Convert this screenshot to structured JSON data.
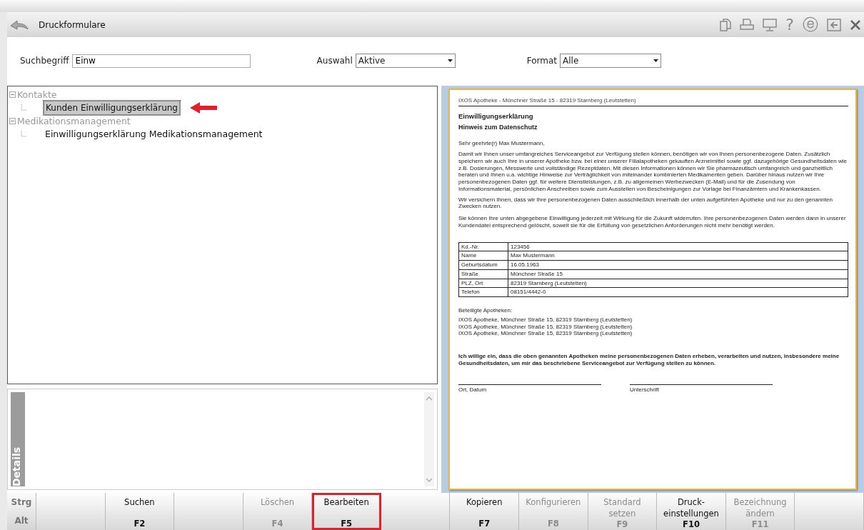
{
  "window": {
    "title": "Druckformulare"
  },
  "title_icons": [
    {
      "kind": "copy"
    },
    {
      "kind": "print"
    },
    {
      "kind": "monitor"
    },
    {
      "kind": "glyph",
      "glyph": "?"
    },
    {
      "kind": "glyph",
      "glyph": "ⓔ"
    },
    {
      "kind": "exit"
    },
    {
      "kind": "close"
    }
  ],
  "filters": {
    "search": {
      "label": "Suchbegriff",
      "value": "Einw"
    },
    "auswahl": {
      "label": "Auswahl",
      "value": "Aktive"
    },
    "format": {
      "label": "Format",
      "value": "Alle"
    }
  },
  "tree": [
    {
      "label": "Kontakte",
      "expanded": true,
      "children": [
        {
          "label": "Kunden Einwilligungserklärung",
          "selected": true,
          "pointer": true
        }
      ]
    },
    {
      "label": "Medikationsmanagement",
      "expanded": true,
      "children": [
        {
          "label": "Einwilligungserklärung Medikationsmanagement",
          "selected": false,
          "pointer": false
        }
      ]
    }
  ],
  "details": {
    "label": "Details"
  },
  "document": {
    "header": "IXOS Apotheke - Münchner Straße 15 - 82319 Starnberg (Leutstetten)",
    "title": "Einwilligungserklärung",
    "subtitle": "Hinweis zum Datenschutz",
    "salutation": "Sehr geehrte(r)  Max Mustermann,",
    "paragraphs": [
      "Damit wir Ihnen unser umfangreiches Serviceangebot zur Verfügung stellen können, benötigen wir von Ihnen personenbezogene Daten. Zusätzlich speichern wir auch Ihre in unserer Apotheke bzw. bei einer unserer Filialapotheken gekauften Arzneimittel sowie ggf. dazugehörige Gesundheitsdaten wie z.B. Dosierungen, Messwerte und vollständige Rezeptdaten. Mit diesen Informationen können wir Sie pharmazeutisch umfangreich und ganzheitlich beraten und Ihnen u.a. wichtige Hinweise zur Verträglichkeit von miteinander kombinierten Medikamenten geben. Darüber hinaus nutzen wir Ihre personenbezogenen Daten ggf. für weitere Dienstleistungen, z.B. zu allgemeinen Werbezwecken (E-Mail) und für die Zusendung von Informationsmaterial, persönlichen Anschreiben sowie zum Ausstellen von Bescheinigungen zur Vorlage bei Finanzämtern und Krankenkassen.",
      "Wir versichern Ihnen, dass wir Ihre personenbezogenen Daten ausschließlich innerhalb der unten aufgeführten Apotheke und nur zu den genannten Zwecken nutzen.",
      "Sie können Ihre unten abgegebene Einwilligung jederzeit mit Wirkung für die Zukunft widerrufen. Ihre personenbezogenen Daten werden dann in unserer Kundendatei entsprechend gelöscht, soweit sie für die Erfüllung von gesetzlichen Anforderungen nicht mehr benötigt werden."
    ],
    "table": [
      {
        "label": "Kd.-Nr.",
        "value": "123456"
      },
      {
        "label": "Name",
        "value": "Max Mustermann"
      },
      {
        "label": "Geburtsdatum",
        "value": "16.05.1963"
      },
      {
        "label": "Straße",
        "value": "Münchner Straße 15"
      },
      {
        "label": "PLZ, Ort",
        "value": "82319 Starnberg (Leutstetten)"
      },
      {
        "label": "Telefon",
        "value": "08151/4442-0"
      }
    ],
    "pharmacies_label": "Beteiligte Apotheken:",
    "pharmacies": [
      "IXOS Apotheke, Münchner Straße 15, 82319 Starnberg (Leutstetten)",
      "IXOS Apotheke, Münchner Straße 15, 82319 Starnberg (Leutstetten)",
      "IXOS Apotheke, Münchner Straße 15, 82319 Starnberg (Leutstetten)"
    ],
    "consent": "Ich willige ein, dass die oben genannten Apotheken meine personenbezogenen Daten erheben, verarbeiten und nutzen, insbesondere meine Gesundheitsdaten, um mir das beschriebene Serviceangebot zur Verfügung stellen zu können.",
    "signatures": [
      "Ort, Datum",
      "Unterschrift"
    ]
  },
  "modifiers": [
    "Strg",
    "Alt"
  ],
  "function_keys": [
    {
      "kind": "blank"
    },
    {
      "kind": "action",
      "label": "Suchen",
      "key": "F2",
      "disabled": false,
      "highlighted": false
    },
    {
      "kind": "blank"
    },
    {
      "kind": "action",
      "label": "Löschen",
      "key": "F4",
      "disabled": true,
      "highlighted": false
    },
    {
      "kind": "action",
      "label": "Bearbeiten",
      "key": "F5",
      "disabled": false,
      "highlighted": true
    },
    {
      "kind": "blank"
    },
    {
      "kind": "action",
      "label": "Kopieren",
      "key": "F7",
      "disabled": false,
      "highlighted": false
    },
    {
      "kind": "action",
      "label": "Konfigurieren",
      "key": "F8",
      "disabled": true,
      "highlighted": false
    },
    {
      "kind": "action",
      "label": "Standard setzen",
      "key": "F9",
      "disabled": true,
      "highlighted": false
    },
    {
      "kind": "action",
      "label": "Druck-einstellungen",
      "key": "F10",
      "disabled": false,
      "highlighted": false
    },
    {
      "kind": "action",
      "label": "Bezeichnung ändern",
      "key": "F11",
      "disabled": true,
      "highlighted": false
    },
    {
      "kind": "blank"
    }
  ]
}
